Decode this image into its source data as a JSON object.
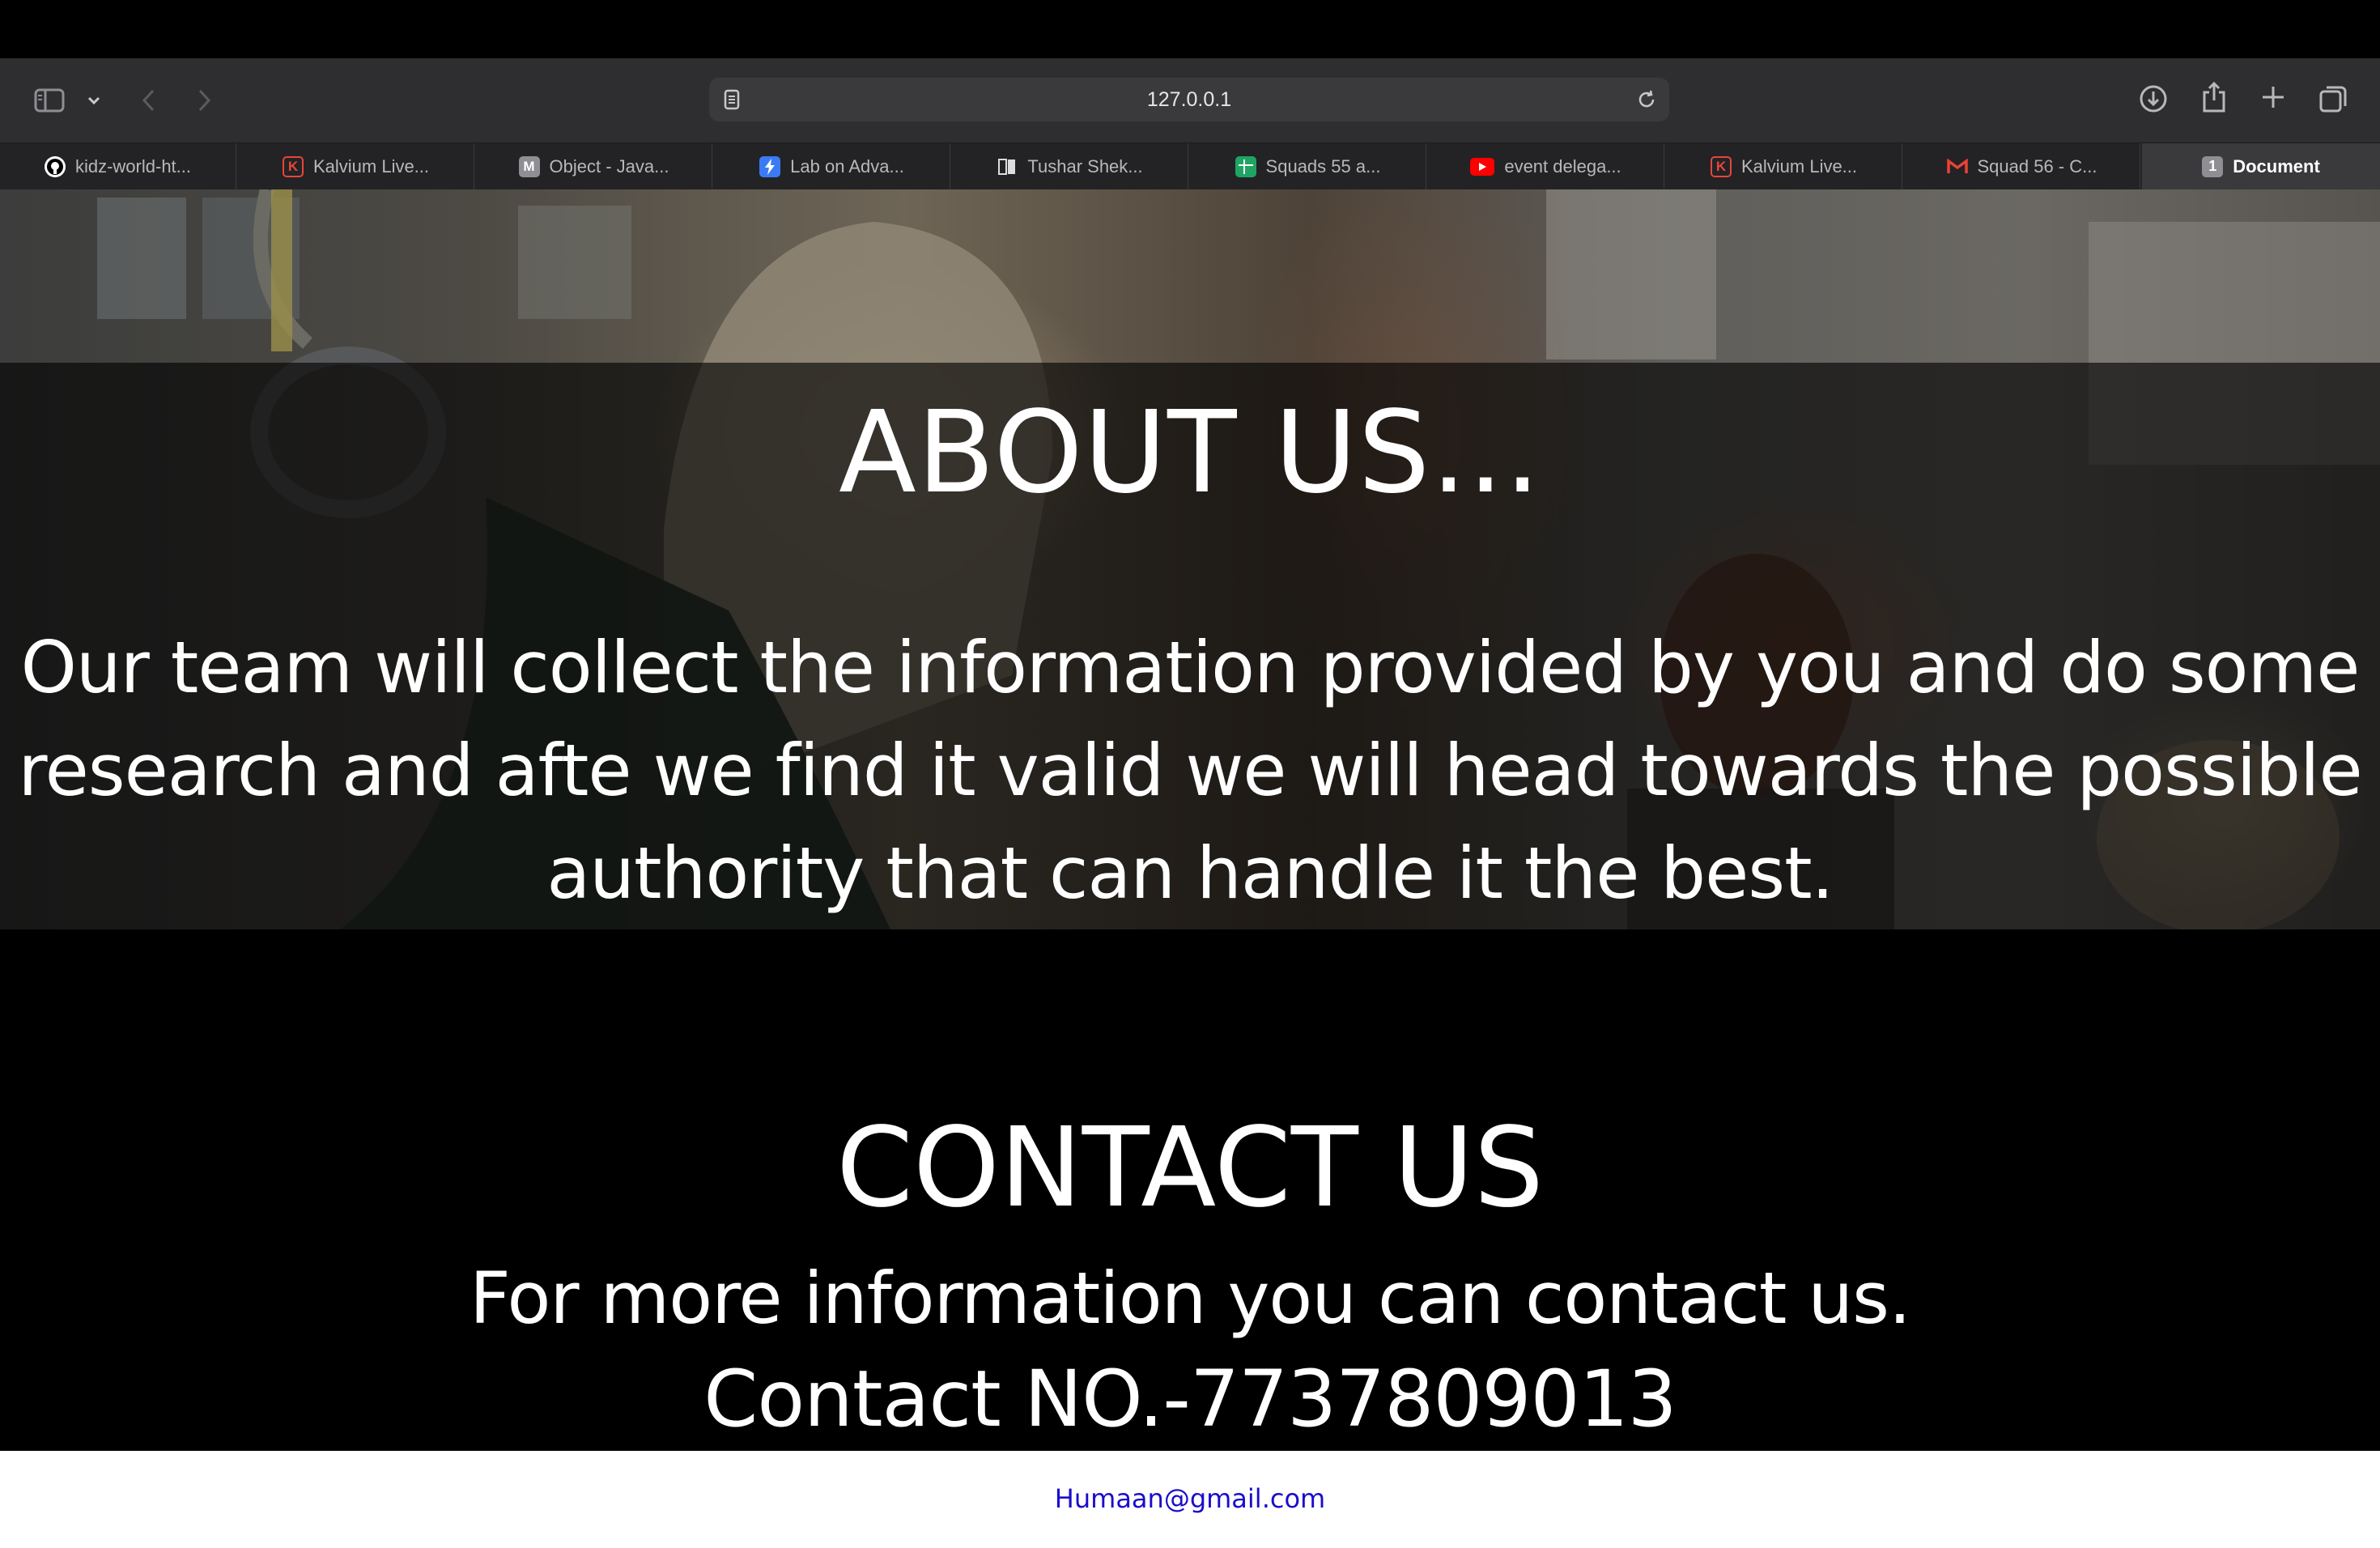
{
  "browser": {
    "url": "127.0.0.1",
    "tabs": [
      {
        "label": "kidz-world-ht...",
        "icon": "github-icon",
        "color": "#ffffff"
      },
      {
        "label": "Kalvium Live...",
        "icon": "kalvium-icon",
        "color": "#e8453c"
      },
      {
        "label": "Object - Java...",
        "icon": "m-letter-icon",
        "color": "#8e8e93"
      },
      {
        "label": "Lab on Adva...",
        "icon": "bolt-icon",
        "color": "#3a7bf5"
      },
      {
        "label": "Tushar Shek...",
        "icon": "book-icon",
        "color": "#d8d8d8"
      },
      {
        "label": "Squads 55 a...",
        "icon": "sheets-icon",
        "color": "#1fa463"
      },
      {
        "label": "event delega...",
        "icon": "youtube-icon",
        "color": "#ff0000"
      },
      {
        "label": "Kalvium Live...",
        "icon": "kalvium-icon",
        "color": "#e8453c"
      },
      {
        "label": "Squad 56 - C...",
        "icon": "gmail-icon",
        "color": "#ea4335"
      },
      {
        "label": "Document",
        "icon": "number-one-icon",
        "badge": "1",
        "color": "#8e8e93",
        "active": true
      }
    ]
  },
  "about": {
    "title": "ABOUT US...",
    "text": "Our team will collect the information provided by you and do some research and afte we find it valid we will head towards the possible authority that can handle it the best."
  },
  "contact": {
    "title": "CONTACT US",
    "text": "For more information you can contact us.",
    "number": "Contact NO.-7737809013"
  },
  "footer": {
    "email": "Humaan@gmail.com"
  }
}
